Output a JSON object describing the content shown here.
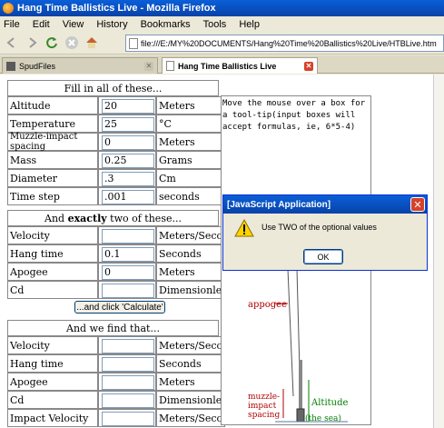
{
  "window": {
    "title": "Hang Time Ballistics Live - Mozilla Firefox"
  },
  "menu": [
    "File",
    "Edit",
    "View",
    "History",
    "Bookmarks",
    "Tools",
    "Help"
  ],
  "address": {
    "url": "file:///E:/MY%20DOCUMENTS/Hang%20Time%20Ballistics%20Live/HTBLive.htm"
  },
  "tabs": [
    {
      "label": "SpudFiles"
    },
    {
      "label": "Hang Time Ballistics Live"
    }
  ],
  "form": {
    "section1": "Fill in all of these...",
    "rows1": [
      {
        "label": "Altitude",
        "value": "20",
        "unit": "Meters"
      },
      {
        "label": "Temperature",
        "value": "25",
        "unit": "°C"
      },
      {
        "label": "Muzzle-impact spacing",
        "value": "0",
        "unit": "Meters"
      },
      {
        "label": "Mass",
        "value": "0.25",
        "unit": "Grams"
      },
      {
        "label": "Diameter",
        "value": ".3",
        "unit": "Cm"
      },
      {
        "label": "Time step",
        "value": ".001",
        "unit": "seconds"
      }
    ],
    "section2_pre": "And ",
    "section2_bold": "exactly",
    "section2_post": " two of these...",
    "rows2": [
      {
        "label": "Velocity",
        "value": "",
        "unit": "Meters/Second"
      },
      {
        "label": "Hang time",
        "value": "0.1",
        "unit": "Seconds"
      },
      {
        "label": "Apogee",
        "value": "0",
        "unit": "Meters"
      },
      {
        "label": "Cd",
        "value": "",
        "unit": "Dimensionless"
      }
    ],
    "calculate_label": "...and click 'Calculate'",
    "section3": "And we find that...",
    "rows3": [
      {
        "label": "Velocity",
        "value": "",
        "unit": "Meters/Second"
      },
      {
        "label": "Hang time",
        "value": "",
        "unit": "Seconds"
      },
      {
        "label": "Apogee",
        "value": "",
        "unit": "Meters"
      },
      {
        "label": "Cd",
        "value": "",
        "unit": "Dimensionless"
      },
      {
        "label": "Impact Velocity",
        "value": "",
        "unit": "Meters/Second"
      }
    ]
  },
  "tip": {
    "text": "Move the mouse over a box for a tool-tip(input boxes will accept formulas, ie, 6*5-4)"
  },
  "diagram": {
    "apogee": "appogee",
    "muzzle_spacing": "muzzle-\nimpact\nspacing",
    "altitude": "Altitude",
    "sea": "(the sea)"
  },
  "dialog": {
    "title": "[JavaScript Application]",
    "message": "Use TWO of the optional values",
    "ok": "OK"
  },
  "colors": {
    "accent": "#0a5fd8",
    "diagram_label": "#b00000",
    "altitude_label": "#008000"
  }
}
